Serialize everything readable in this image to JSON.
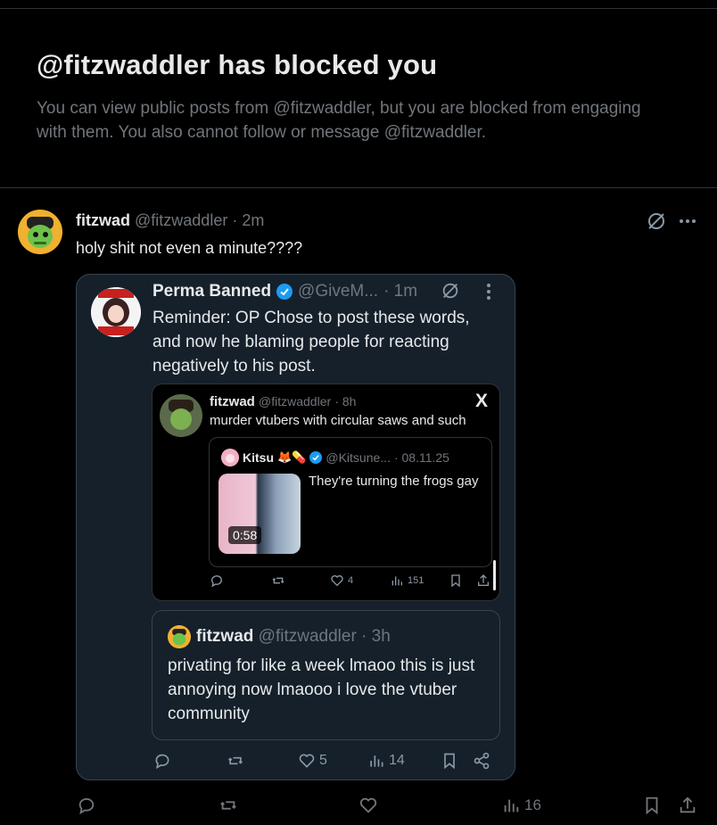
{
  "blocked": {
    "title": "@fitzwaddler has blocked you",
    "description": "You can view public posts from @fitzwaddler, but you are blocked from engaging with them. You also cannot follow or message @fitzwaddler."
  },
  "main_post": {
    "name": "fitzwad",
    "handle": "@fitzwaddler",
    "time": "· 2m",
    "text": "holy shit not even a minute????",
    "actions": {
      "views": "16"
    }
  },
  "quote1": {
    "name": "Perma Banned",
    "handle": "@GiveM...",
    "time": "· 1m",
    "text": "Reminder: OP Chose to post these words, and now he blaming people for reacting negatively to his post.",
    "actions": {
      "likes": "5",
      "views": "14"
    }
  },
  "quote2": {
    "name": "fitzwad",
    "handle": "@fitzwaddler",
    "time": "· 8h",
    "text": "murder vtubers with circular saws and such",
    "x_logo": "X",
    "actions": {
      "likes": "4",
      "views": "151"
    }
  },
  "quote3": {
    "name": "Kitsu",
    "emoji": "🦊💊",
    "handle": "@Kitsune...",
    "time": "· 08.11.25",
    "text": "They're turning the frogs gay",
    "duration": "0:58"
  },
  "quote4": {
    "name": "fitzwad",
    "handle": "@fitzwaddler",
    "time": "· 3h",
    "text": "privating for like a week lmaoo this is just annoying now lmaooo i love the vtuber community"
  },
  "colors": {
    "background": "#000000",
    "card": "#15202b",
    "muted": "#71767b",
    "verified": "#1d9bf0"
  }
}
